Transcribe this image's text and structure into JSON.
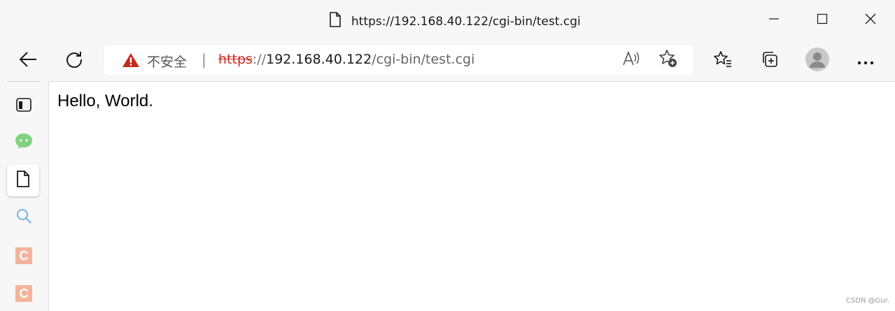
{
  "window": {
    "title": "https://192.168.40.122/cgi-bin/test.cgi",
    "controls": [
      "minimize",
      "maximize",
      "close"
    ]
  },
  "toolbar": {
    "security_label": "不安全",
    "separator": "|",
    "url": {
      "protocol": "https",
      "slashes": "://",
      "host": "192.168.40.122",
      "path": "/cgi-bin/test.cgi"
    },
    "icons": [
      "back-icon",
      "refresh-icon",
      "warning-icon",
      "read-aloud-icon",
      "add-favorite-icon",
      "favorites-icon",
      "collections-icon",
      "profile-icon",
      "more-icon"
    ]
  },
  "sidebar": {
    "items": [
      {
        "name": "tabs-icon"
      },
      {
        "name": "wechat-icon"
      },
      {
        "name": "page-icon",
        "active": true
      },
      {
        "name": "search-icon"
      },
      {
        "name": "csdn-icon",
        "label": "C"
      },
      {
        "name": "csdn-icon-2",
        "label": "C"
      }
    ]
  },
  "content": {
    "body_text": "Hello, World."
  },
  "watermark": "CSDN @Gur.",
  "colors": {
    "warning": "#c42b1c",
    "chrome_bg": "#f7f7f7",
    "badge": "#f4b49c",
    "wechat": "#7fd27f",
    "search": "#7ab0e0"
  }
}
